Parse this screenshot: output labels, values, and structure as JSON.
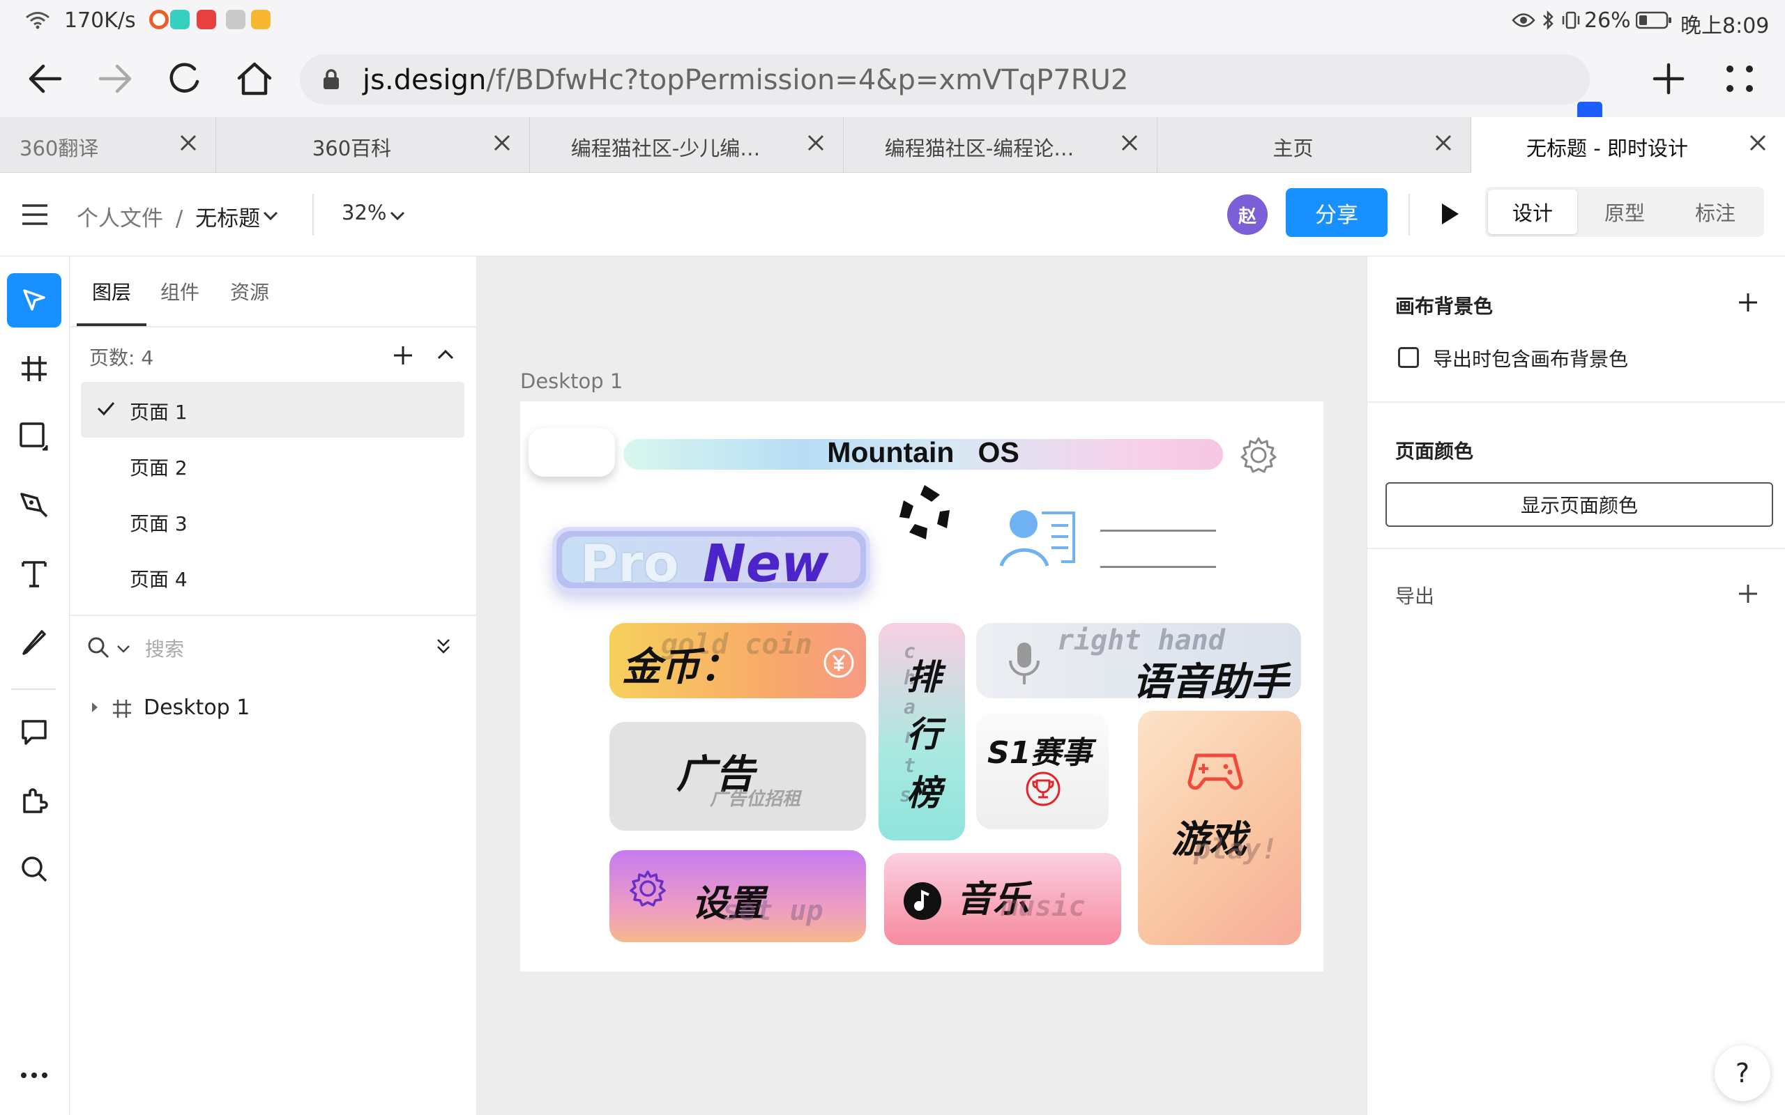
{
  "status_bar": {
    "speed": "170K/s",
    "battery": "26%",
    "time": "晚上8:09"
  },
  "browser": {
    "url_host": "js.design",
    "url_path": "/f/BDfwHc?topPermission=4&p=xmVTqP7RU2"
  },
  "tabs": [
    {
      "label": "360翻译"
    },
    {
      "label": "360百科"
    },
    {
      "label": "编程猫社区-少儿编…"
    },
    {
      "label": "编程猫社区-编程论…"
    },
    {
      "label": "主页"
    },
    {
      "label": "无标题 - 即时设计"
    }
  ],
  "toolbar": {
    "breadcrumb_root": "个人文件",
    "breadcrumb_sep": "/",
    "file_name": "无标题",
    "zoom": "32%",
    "avatar": "赵",
    "share": "分享",
    "modes": [
      "设计",
      "原型",
      "标注"
    ]
  },
  "layers_panel": {
    "tabs": [
      "图层",
      "组件",
      "资源"
    ],
    "page_count_label": "页数:  4",
    "pages": [
      "页面 1",
      "页面 2",
      "页面 3",
      "页面 4"
    ],
    "search_placeholder": "搜索",
    "layer_items": [
      "Desktop 1"
    ]
  },
  "canvas": {
    "frame_label": "Desktop 1",
    "design": {
      "os_title": "Mountain   OS",
      "pro": "Pro",
      "new": "New",
      "coin_title": "金币：",
      "coin_ghost": "gold coin",
      "rank_title": [
        "排",
        "行",
        "榜"
      ],
      "rank_ghost": [
        "c",
        "h",
        "a",
        "r",
        "t",
        "s"
      ],
      "voice_ghost": "right hand",
      "voice_title": "语音助手",
      "ad_title": "广告",
      "ad_sub": "广告位招租",
      "s1_title": "S1赛事",
      "game_title": "游戏",
      "game_ghost": "play!",
      "settings_title": "设置",
      "settings_ghost": "set up",
      "music_title": "音乐",
      "music_ghost": "music"
    }
  },
  "props_panel": {
    "canvas_bg_title": "画布背景色",
    "export_bg_label": "导出时包含画布背景色",
    "page_color_title": "页面颜色",
    "show_page_color": "显示页面颜色",
    "export_title": "导出",
    "help": "?"
  }
}
